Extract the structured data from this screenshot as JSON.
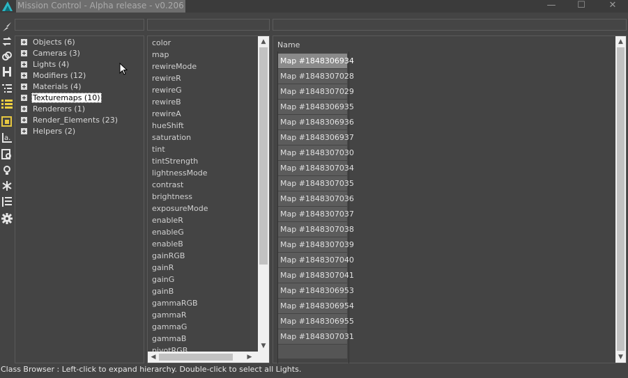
{
  "window": {
    "title": "Mission Control - Alpha release - v0.206",
    "controls": {
      "minimize": "—",
      "maximize": "☐",
      "close": "✕"
    }
  },
  "toolbar": {
    "icons": [
      "lightning-icon",
      "swap-icon",
      "link-icon",
      "hierarchy-icon",
      "indent-list-icon",
      "list-icon",
      "layer-icon",
      "text-a-icon",
      "search-doc-icon",
      "bulb-icon",
      "snowflake-icon",
      "sort-list-icon",
      "gear-icon"
    ]
  },
  "tree": {
    "items": [
      {
        "label": "Objects (6)"
      },
      {
        "label": "Cameras (3)"
      },
      {
        "label": "Lights (4)"
      },
      {
        "label": "Modifiers (12)"
      },
      {
        "label": "Materials (4)"
      },
      {
        "label": "Texturemaps (10)",
        "selected": true
      },
      {
        "label": "Renderers (1)"
      },
      {
        "label": "Render_Elements (23)"
      },
      {
        "label": "Helpers (2)"
      }
    ]
  },
  "properties": {
    "items": [
      "color",
      "map",
      "rewireMode",
      "rewireR",
      "rewireG",
      "rewireB",
      "rewireA",
      "hueShift",
      "saturation",
      "tint",
      "tintStrength",
      "lightnessMode",
      "contrast",
      "brightness",
      "exposureMode",
      "enableR",
      "enableG",
      "enableB",
      "gainRGB",
      "gainR",
      "gainG",
      "gainB",
      "gammaRGB",
      "gammaR",
      "gammaG",
      "gammaB",
      "pivotRGB"
    ]
  },
  "list": {
    "column_header": "Name",
    "items": [
      {
        "label": "Map #1848306934",
        "selected": true
      },
      {
        "label": "Map #1848307028"
      },
      {
        "label": "Map #1848307029"
      },
      {
        "label": "Map #1848306935"
      },
      {
        "label": "Map #1848306936"
      },
      {
        "label": "Map #1848306937"
      },
      {
        "label": "Map #1848307030"
      },
      {
        "label": "Map #1848307034"
      },
      {
        "label": "Map #1848307035"
      },
      {
        "label": "Map #1848307036"
      },
      {
        "label": "Map #1848307037"
      },
      {
        "label": "Map #1848307038"
      },
      {
        "label": "Map #1848307039"
      },
      {
        "label": "Map #1848307040"
      },
      {
        "label": "Map #1848307041"
      },
      {
        "label": "Map #1848306953"
      },
      {
        "label": "Map #1848306954"
      },
      {
        "label": "Map #1848306955"
      },
      {
        "label": "Map #1848307031"
      }
    ]
  },
  "status": {
    "text": "Class Browser : Left-click to expand hierarchy. Double-click to select all Lights."
  },
  "colors": {
    "background": "#444444",
    "selection": "#8a8a8a",
    "cell": "#5c5c5c"
  }
}
